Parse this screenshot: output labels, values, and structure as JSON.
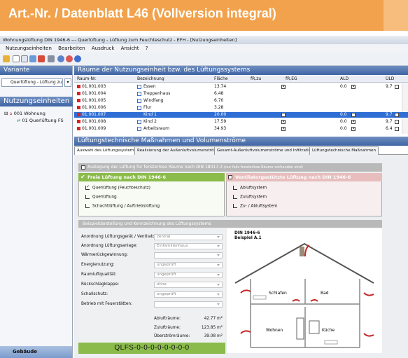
{
  "banner": {
    "title": "Art.-Nr. / Datenblatt L46 (Vollversion integral)"
  },
  "window": {
    "title": "Wohnungslüftung DIN 1946-6 --- Querlüftung - Lüftung zum Feuchteschutz - EFH - [Nutzungseinheiten]"
  },
  "menu": [
    "Nutzungseinheiten",
    "Bearbeiten",
    "Ausdruck",
    "Ansicht",
    "?"
  ],
  "toolbar_icons": [
    "open-icon",
    "new-icon",
    "copy-icon",
    "paste-icon",
    "print-icon",
    "preview-icon",
    "search-icon",
    "refresh-icon",
    "help-icon"
  ],
  "left": {
    "variant_header": "Variante",
    "variant_value": "Querlüftung - Lüftung zu",
    "nutz_header": "Nutzungseinheiten",
    "tree": [
      {
        "label": "001 Wohnung"
      },
      {
        "label": "01 Querlüftung FS"
      }
    ],
    "footer": "Gebäude"
  },
  "rooms": {
    "header": "Räume der Nutzungseinheit bzw. des Lüftungssystems",
    "columns": [
      "Raum-Nr.",
      "Bezeichnung",
      "Fläche",
      "fR,zu",
      "fR,EG",
      "ALD",
      "ÜLD"
    ],
    "rows": [
      {
        "nr": "01.001.003",
        "name": "Essen",
        "area": "13.74",
        "eg": true,
        "ald": "0.0",
        "ald_cb": true,
        "uld": "9.7",
        "uld_cb": false,
        "sel": false
      },
      {
        "nr": "01.001.004",
        "name": "Treppenhaus",
        "area": "6.48",
        "eg": false,
        "ald": "",
        "ald_cb": false,
        "uld": "",
        "uld_cb": false,
        "sel": false
      },
      {
        "nr": "01.001.005",
        "name": "Windfang",
        "area": "6.70",
        "eg": false,
        "ald": "",
        "ald_cb": false,
        "uld": "",
        "uld_cb": false,
        "sel": false
      },
      {
        "nr": "01.001.006",
        "name": "Flur",
        "area": "3.28",
        "eg": false,
        "ald": "",
        "ald_cb": false,
        "uld": "",
        "uld_cb": false,
        "sel": false
      },
      {
        "nr": "01.001.007",
        "name": "Kind 1",
        "area": "20.00",
        "eg": true,
        "ald": "0.0",
        "ald_cb": true,
        "uld": "9.7",
        "uld_cb": false,
        "sel": true
      },
      {
        "nr": "01.001.008",
        "name": "Kind 2",
        "area": "17.59",
        "eg": true,
        "ald": "0.0",
        "ald_cb": true,
        "uld": "9.7",
        "uld_cb": false,
        "sel": false
      },
      {
        "nr": "01.001.009",
        "name": "Arbeitsraum",
        "area": "34.93",
        "eg": true,
        "ald": "0.0",
        "ald_cb": true,
        "uld": "6.4",
        "uld_cb": false,
        "sel": false
      }
    ]
  },
  "ltm": {
    "header": "Lüftungstechnische Maßnahmen und Volumenströme",
    "tabs": [
      "Auswahl des Lüftungssystems",
      "Realisierung der Außenluftvolumenströme",
      "Gesamt-Außenluftvolumenströme und Infiltration",
      "Lüftungstechnische Maßnahmen"
    ],
    "bar1": "Auslegung der Lüftung für fensterlose Räume nach DIN 18017-3",
    "bar1_note": "(nur falls fensterlose Räume vorhanden sind)",
    "frei_title": "Freie Lüftung nach DIN 1946-6",
    "frei_opts": [
      "Querlüftung (Feuchteschutz)",
      "Querlüftung",
      "Schachtlüftung / Auftriebslüftung"
    ],
    "vent_title": "Ventilatorgestützte Lüftung nach DIN 1946-6",
    "vent_opts": [
      "Abluftsystem",
      "Zuluftsystem",
      "Zu- / Abluftsystem"
    ],
    "bar2": "Beispieldarstellung und Kennzeichnung des Lüftungssystems",
    "fields": [
      {
        "label": "Anordnung Lüftungsgerät / Ventilator:",
        "value": "zentral"
      },
      {
        "label": "Anordnung Lüftungsanlage:",
        "value": "Einfamilienhaus"
      },
      {
        "label": "Wärmerückgewinnung:",
        "value": ""
      },
      {
        "label": "Energienutzung:",
        "value": "ungeprüft"
      },
      {
        "label": "Raumluftqualität:",
        "value": "ungeprüft"
      },
      {
        "label": "Rückschlagklappe:",
        "value": "ohne"
      },
      {
        "label": "Schallschutz:",
        "value": "ungeprüft"
      },
      {
        "label": "Betrieb mit Feuerstätten:",
        "value": ""
      }
    ],
    "sums": [
      {
        "label": "Ablufträume:",
        "value": "42.77 m²"
      },
      {
        "label": "Zulufträume:",
        "value": "123.85 m²"
      },
      {
        "label": "Überströmräume:",
        "value": "39.08 m²"
      }
    ],
    "code": "QLFS-0-0-0-0-0-0-0-0",
    "diagram_label": "DIN 1946-6\nBeispiel A.1",
    "rooms_diagram": [
      "Schlafen",
      "Bad",
      "Wohnen",
      "Küche"
    ]
  },
  "colors": {
    "banner": "#f2a24c",
    "green": "#8bbb4b",
    "rose": "#e7bdbd",
    "header_blue": "#3e64a4",
    "selection": "#2f6ed4",
    "arrow_red": "#c62828"
  }
}
